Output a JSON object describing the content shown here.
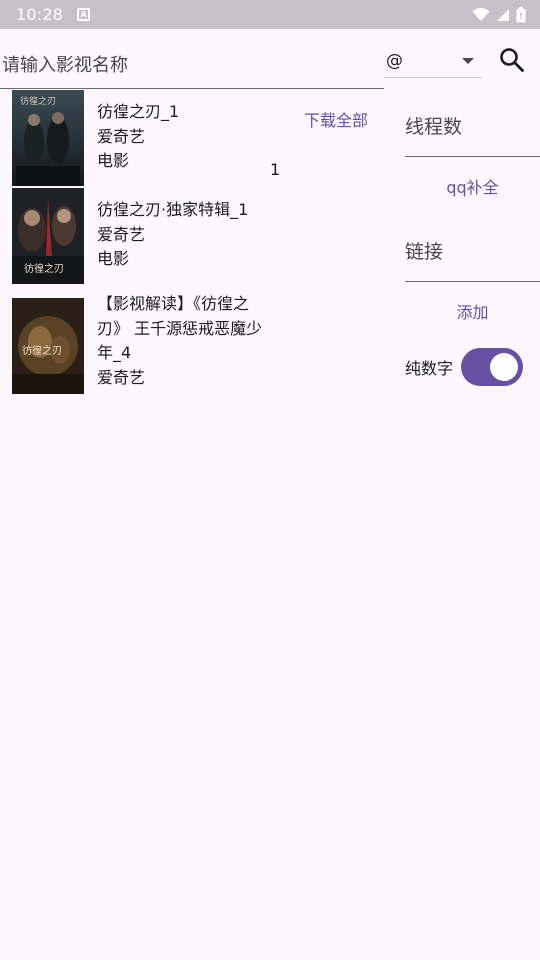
{
  "status_bar": {
    "time": "10:28",
    "notification_icon": "a-notification-icon",
    "icons": [
      "wifi-icon",
      "signal-icon",
      "battery-icon"
    ]
  },
  "search": {
    "placeholder": "请输入影视名称",
    "value": "",
    "source_selected": "@",
    "button_icon": "search-icon"
  },
  "results": [
    {
      "title": "彷徨之刃_1",
      "source": "爱奇艺",
      "type": "电影",
      "poster": {
        "icon": "movie-poster",
        "text": "彷徨之刃"
      }
    },
    {
      "title": "彷徨之刃·独家特辑_1",
      "source": "爱奇艺",
      "type": "电影",
      "poster": {
        "icon": "movie-poster",
        "text": "彷徨之刃"
      }
    },
    {
      "title": "【影视解读】《彷徨之刃》 王千源惩戒恶魔少年_4",
      "source": "爱奇艺",
      "type": "",
      "poster": {
        "icon": "movie-poster",
        "text": "彷徨之刃"
      }
    }
  ],
  "download_all_label": "下载全部",
  "count_label": "1",
  "side": {
    "threads_label": "线程数",
    "qq_complete_label": "qq补全",
    "link_label": "链接",
    "add_label": "添加",
    "digits_only_label": "纯数字",
    "digits_only_checked": true
  },
  "colors": {
    "accent": "#6750a4",
    "background": "#fdf7fd",
    "status_bar": "#c6c1c9"
  }
}
